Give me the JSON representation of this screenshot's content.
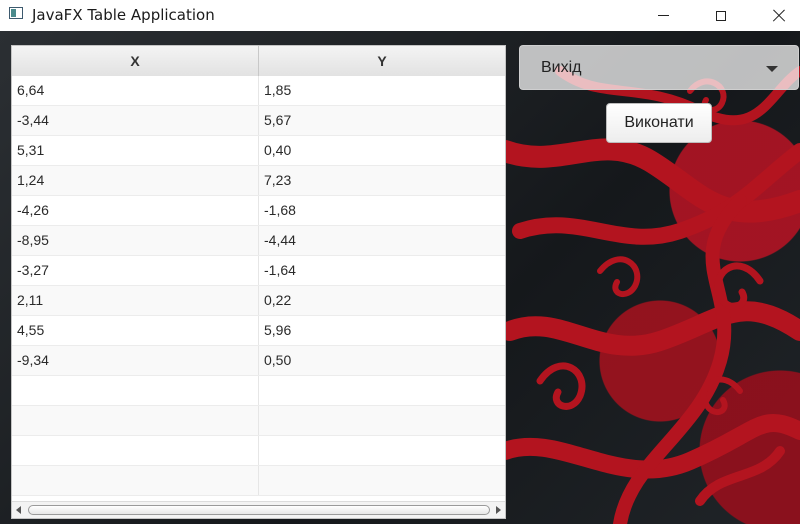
{
  "window": {
    "title": "JavaFX Table Application",
    "icon": "app-window-icon",
    "controls": [
      "minimize-icon",
      "maximize-icon",
      "close-icon"
    ]
  },
  "table": {
    "columns": [
      {
        "header": "X"
      },
      {
        "header": "Y"
      }
    ],
    "rows": [
      {
        "x": "6,64",
        "y": "1,85"
      },
      {
        "x": "-3,44",
        "y": "5,67"
      },
      {
        "x": "5,31",
        "y": "0,40"
      },
      {
        "x": "1,24",
        "y": "7,23"
      },
      {
        "x": "-4,26",
        "y": "-1,68"
      },
      {
        "x": "-8,95",
        "y": "-4,44"
      },
      {
        "x": "-3,27",
        "y": "-1,64"
      },
      {
        "x": "2,11",
        "y": "0,22"
      },
      {
        "x": "4,55",
        "y": "5,96"
      },
      {
        "x": "-9,34",
        "y": "0,50"
      },
      {
        "x": "",
        "y": ""
      },
      {
        "x": "",
        "y": ""
      },
      {
        "x": "",
        "y": ""
      },
      {
        "x": "",
        "y": ""
      }
    ]
  },
  "controls": {
    "combo_value": "Вихід",
    "execute_label": "Виконати"
  },
  "colors": {
    "accent_red": "#b0141f",
    "background_dark": "#1c1f22"
  }
}
